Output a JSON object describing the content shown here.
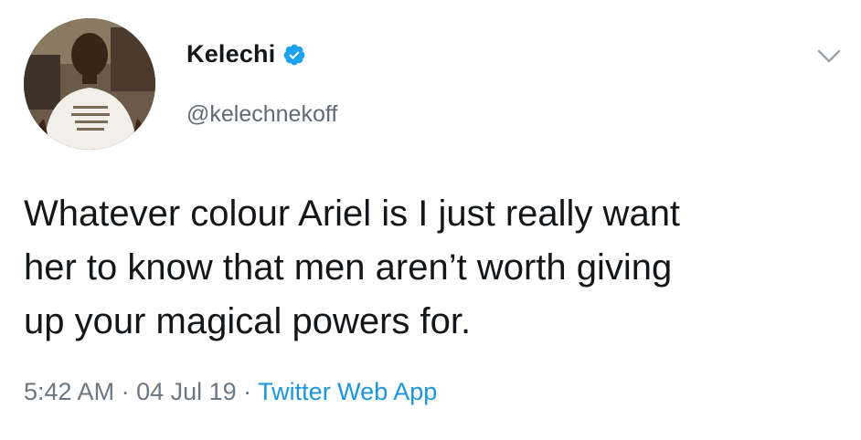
{
  "tweet": {
    "display_name": "Kelechi",
    "handle": "@kelechnekoff",
    "verified": true,
    "text": "Whatever colour Ariel is I just really want\nher to know that men aren’t worth giving\nup your magical powers for.",
    "time": "5:42 AM",
    "separator": " · ",
    "date": "04 Jul 19",
    "source": "Twitter Web App"
  },
  "colors": {
    "text": "#14171a",
    "secondary": "#5f6b77",
    "link": "#1b95e0",
    "verified_badge": "#1da1f2"
  },
  "icons": {
    "avatar": "profile-photo",
    "verified": "verified-badge-icon",
    "more": "chevron-down-icon"
  }
}
